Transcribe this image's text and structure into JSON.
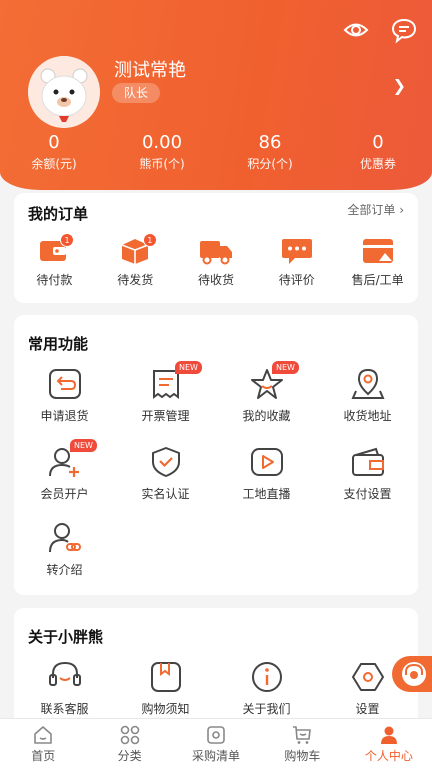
{
  "profile": {
    "name": "测试常艳",
    "role": "队长"
  },
  "stats": [
    {
      "value": "0",
      "label": "余额(元)"
    },
    {
      "value": "0.00",
      "label": "熊币(个)"
    },
    {
      "value": "86",
      "label": "积分(个)"
    },
    {
      "value": "0",
      "label": "优惠券"
    }
  ],
  "orders": {
    "title": "我的订单",
    "all_link": "全部订单",
    "items": [
      {
        "label": "待付款",
        "icon": "wallet-icon",
        "badge": "1"
      },
      {
        "label": "待发货",
        "icon": "package-icon",
        "badge": "1"
      },
      {
        "label": "待收货",
        "icon": "truck-icon"
      },
      {
        "label": "待评价",
        "icon": "chat-bubble-icon"
      },
      {
        "label": "售后/工单",
        "icon": "aftersale-icon"
      }
    ]
  },
  "functions": {
    "title": "常用功能",
    "items": [
      {
        "label": "申请退货",
        "icon": "return-icon"
      },
      {
        "label": "开票管理",
        "icon": "invoice-icon",
        "badge": "NEW"
      },
      {
        "label": "我的收藏",
        "icon": "star-icon",
        "badge": "NEW"
      },
      {
        "label": "收货地址",
        "icon": "location-icon"
      },
      {
        "label": "会员开户",
        "icon": "add-user-icon",
        "badge": "NEW"
      },
      {
        "label": "实名认证",
        "icon": "shield-check-icon"
      },
      {
        "label": "工地直播",
        "icon": "live-play-icon"
      },
      {
        "label": "支付设置",
        "icon": "wallet-settings-icon"
      },
      {
        "label": "转介绍",
        "icon": "referral-icon"
      }
    ]
  },
  "about": {
    "title": "关于小胖熊",
    "items": [
      {
        "label": "联系客服",
        "icon": "headset-icon"
      },
      {
        "label": "购物须知",
        "icon": "notice-book-icon"
      },
      {
        "label": "关于我们",
        "icon": "info-icon"
      },
      {
        "label": "设置",
        "icon": "settings-icon"
      }
    ]
  },
  "tabbar": [
    {
      "label": "首页",
      "icon": "home-icon"
    },
    {
      "label": "分类",
      "icon": "category-icon"
    },
    {
      "label": "采购清单",
      "icon": "list-icon"
    },
    {
      "label": "购物车",
      "icon": "cart-icon"
    },
    {
      "label": "个人中心",
      "icon": "user-icon",
      "active": true
    }
  ],
  "colors": {
    "accent": "#f0602f",
    "badge": "#f04a3a",
    "background": "#f4f4f4"
  }
}
